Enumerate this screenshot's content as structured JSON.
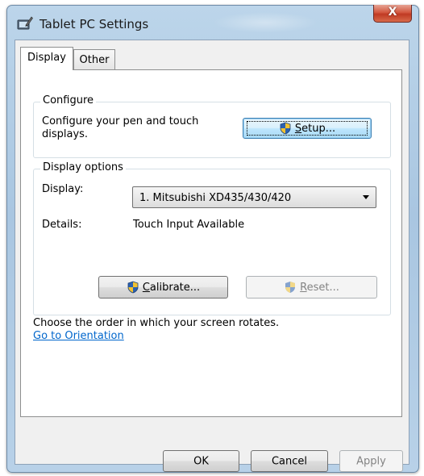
{
  "window": {
    "title": "Tablet PC Settings",
    "close_label": "X"
  },
  "tabs": [
    {
      "label": "Display",
      "selected": true
    },
    {
      "label": "Other",
      "selected": false
    }
  ],
  "configure": {
    "group_title": "Configure",
    "description": "Configure your pen and touch displays.",
    "setup_button": {
      "underlined": "S",
      "rest": "etup..."
    }
  },
  "display_options": {
    "group_title": "Display options",
    "display_label": "Display:",
    "display_value": "1. Mitsubishi XD435/430/420",
    "details_label": "Details:",
    "details_value": "Touch Input Available",
    "calibrate_button": {
      "underlined": "C",
      "rest": "alibrate..."
    },
    "reset_button": {
      "underlined": "R",
      "rest": "eset...",
      "enabled": false
    }
  },
  "orientation": {
    "text": "Choose the order in which your screen rotates.",
    "link": "Go to Orientation"
  },
  "footer": {
    "ok": "OK",
    "cancel": "Cancel",
    "apply": "Apply",
    "apply_enabled": false
  },
  "icons": {
    "title": "tablet-pen-icon",
    "uac": "uac-shield-icon"
  }
}
